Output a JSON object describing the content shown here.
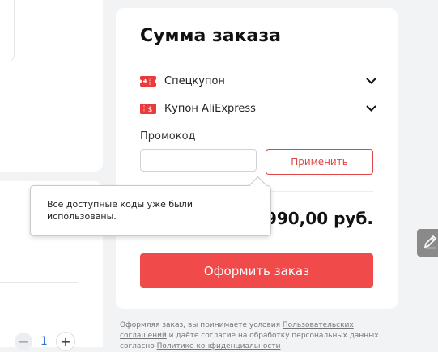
{
  "summary": {
    "title": "Сумма заказа",
    "coupons": [
      {
        "label": "Спецкупон",
        "icon": "ticket-plus-icon"
      },
      {
        "label": "Купон AliExpress",
        "icon": "ticket-dollar-icon"
      }
    ],
    "promo_label": "Промокод",
    "promo_value": "",
    "apply_label": "Применить",
    "total": "990,00 руб.",
    "checkout_label": "Оформить заказ"
  },
  "tooltip": {
    "text": "Все доступные коды уже были использованы."
  },
  "legal": {
    "prefix": "Оформляя заказ, вы принимаете условия ",
    "link1": "Пользовательских соглашений",
    "middle": " и даёте согласие на обработку персональных данных согласно ",
    "link2": "Политике конфиденциальности"
  },
  "cart": {
    "quantity": "1"
  },
  "colors": {
    "accent": "#f04a4a",
    "coupon_icon": "#ea3a3a",
    "link_blue": "#3574d4"
  }
}
